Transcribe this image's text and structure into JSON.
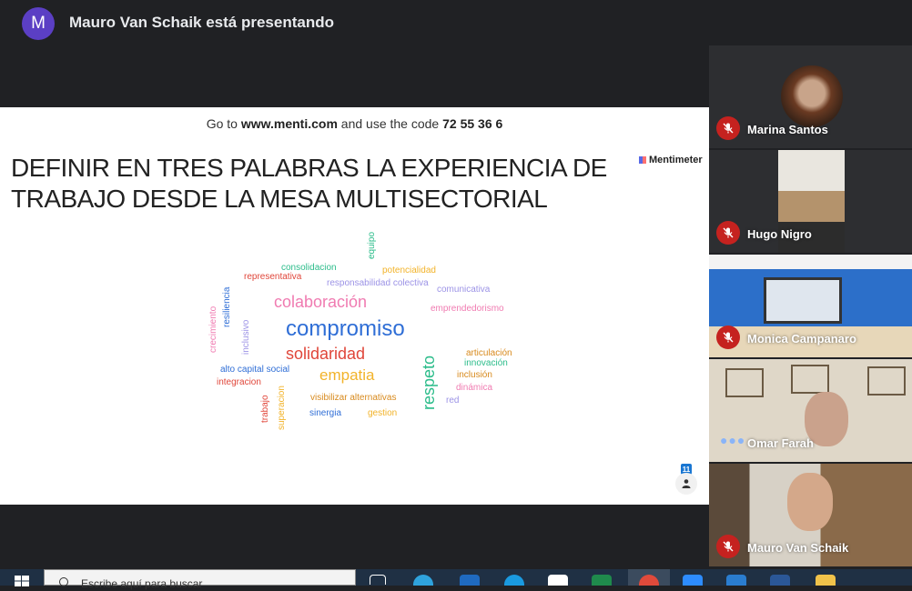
{
  "presenter": {
    "initial": "M",
    "label": "Mauro Van Schaik está presentando"
  },
  "slide": {
    "instruction_pre": "Go to",
    "instruction_url": "www.menti.com",
    "instruction_mid": "and use the code",
    "instruction_code": "72 55 36 6",
    "brand": "Mentimeter",
    "question": "DEFINIR EN TRES PALABRAS LA EXPERIENCIA DE TRABAJO DESDE LA MESA MULTISECTORIAL",
    "respondent_count": "11",
    "words": [
      {
        "text": "equipo",
        "color": "#2bbc8a"
      },
      {
        "text": "consolidacion",
        "color": "#2bbc8a"
      },
      {
        "text": "potencialidad",
        "color": "#f2b32a"
      },
      {
        "text": "representativa",
        "color": "#e0463a"
      },
      {
        "text": "responsabilidad colectiva",
        "color": "#9c93e6"
      },
      {
        "text": "comunicativa",
        "color": "#9c93e6"
      },
      {
        "text": "colaboración",
        "color": "#f07bb1"
      },
      {
        "text": "emprendedorismo",
        "color": "#f07bb1"
      },
      {
        "text": "resiliencia",
        "color": "#2f6ed6"
      },
      {
        "text": "crecimiento",
        "color": "#f07bb1"
      },
      {
        "text": "inclusivo",
        "color": "#9c93e6"
      },
      {
        "text": "compromiso",
        "color": "#2f6ed6"
      },
      {
        "text": "solidaridad",
        "color": "#e0463a"
      },
      {
        "text": "respeto",
        "color": "#2bbc8a"
      },
      {
        "text": "articulación",
        "color": "#d88a1d"
      },
      {
        "text": "innovación",
        "color": "#2bbc8a"
      },
      {
        "text": "alto capital social",
        "color": "#2f6ed6"
      },
      {
        "text": "empatia",
        "color": "#f2b32a"
      },
      {
        "text": "inclusión",
        "color": "#d88a1d"
      },
      {
        "text": "integracion",
        "color": "#e0463a"
      },
      {
        "text": "dinámica",
        "color": "#f07bb1"
      },
      {
        "text": "trabajo",
        "color": "#e0463a"
      },
      {
        "text": "superacion",
        "color": "#f2b32a"
      },
      {
        "text": "visibilizar alternativas",
        "color": "#d88a1d"
      },
      {
        "text": "red",
        "color": "#9c93e6"
      },
      {
        "text": "sinergia",
        "color": "#2f6ed6"
      },
      {
        "text": "gestion",
        "color": "#f2b32a"
      }
    ]
  },
  "participants": [
    {
      "name": "Marina Santos",
      "status": "muted"
    },
    {
      "name": "Hugo Nigro",
      "status": "muted"
    },
    {
      "name": "Monica Campanaro",
      "status": "muted"
    },
    {
      "name": "Omar Farah",
      "status": "speaking"
    },
    {
      "name": "Mauro Van Schaik",
      "status": "muted"
    }
  ],
  "taskbar": {
    "search_placeholder": "Escribe aquí para buscar"
  },
  "colors": {
    "meet_bg": "#202124",
    "muted_red": "#c5221f",
    "presenter_avatar": "#5b3fc4",
    "taskbar": "#1f3044"
  }
}
